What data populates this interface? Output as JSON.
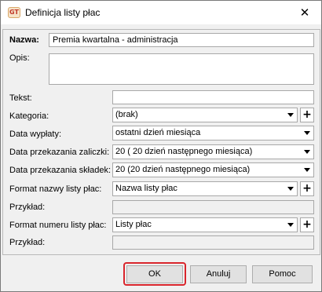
{
  "window": {
    "title": "Definicja listy płac",
    "icon": "app-logo-icon",
    "icon_text": "GT",
    "close_glyph": "✕"
  },
  "form": {
    "nazwa_label": "Nazwa:",
    "nazwa_value": "Premia kwartalna - administracja",
    "opis_label": "Opis:",
    "opis_value": "",
    "tekst_label": "Tekst:",
    "tekst_value": "",
    "kategoria_label": "Kategoria:",
    "kategoria_value": "(brak)",
    "data_wyplaty_label": "Data wypłaty:",
    "data_wyplaty_value": "ostatni dzień miesiąca",
    "data_zaliczki_label": "Data przekazania zaliczki:",
    "data_zaliczki_value": "20 ( 20 dzień następnego miesiąca)",
    "data_skladek_label": "Data przekazania składek:",
    "data_skladek_value": "20 (20 dzień następnego miesiąca)",
    "format_nazwy_label": "Format nazwy listy płac:",
    "format_nazwy_value": "Nazwa listy płac",
    "przyklad1_label": "Przykład:",
    "przyklad1_value": "",
    "format_numeru_label": "Format numeru listy płac:",
    "format_numeru_value": "Listy płac",
    "przyklad2_label": "Przykład:",
    "przyklad2_value": "",
    "plus_glyph": "+"
  },
  "buttons": {
    "ok": "OK",
    "cancel": "Anuluj",
    "help": "Pomoc"
  },
  "colors": {
    "highlight": "#d9252c"
  }
}
